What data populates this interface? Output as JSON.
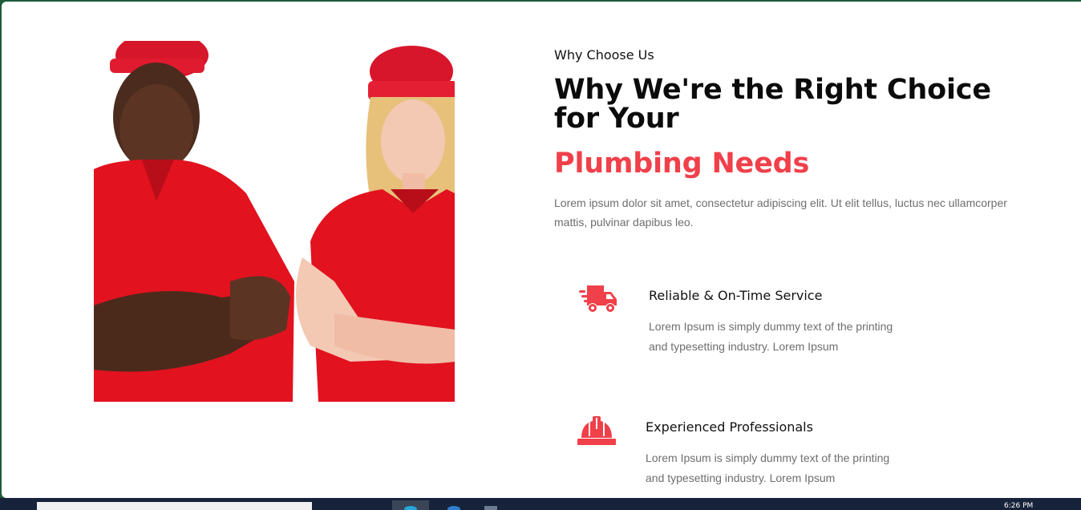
{
  "section": {
    "eyebrow": "Why Choose Us",
    "headline": "Why We're the Right Choice for Your",
    "headline_accent": "Plumbing Needs",
    "intro": "Lorem ipsum dolor sit amet, consectetur adipiscing elit. Ut elit tellus, luctus nec ullamcorper mattis, pulvinar dapibus leo.",
    "accent_color": "#f0404a",
    "photo": {
      "alt": "Two workers in red caps and red polo shirts with arms crossed",
      "icon": "team-photo"
    }
  },
  "features": [
    {
      "icon": "delivery-truck-icon",
      "title": "Reliable & On-Time Service",
      "desc": "Lorem Ipsum is simply dummy text of the printing and typesetting industry. Lorem Ipsum"
    },
    {
      "icon": "hard-hat-icon",
      "title": "Experienced Professionals",
      "desc": "Lorem Ipsum is simply dummy text of the printing and typesetting industry. Lorem Ipsum"
    }
  ],
  "taskbar": {
    "clock": "6:26 PM"
  }
}
